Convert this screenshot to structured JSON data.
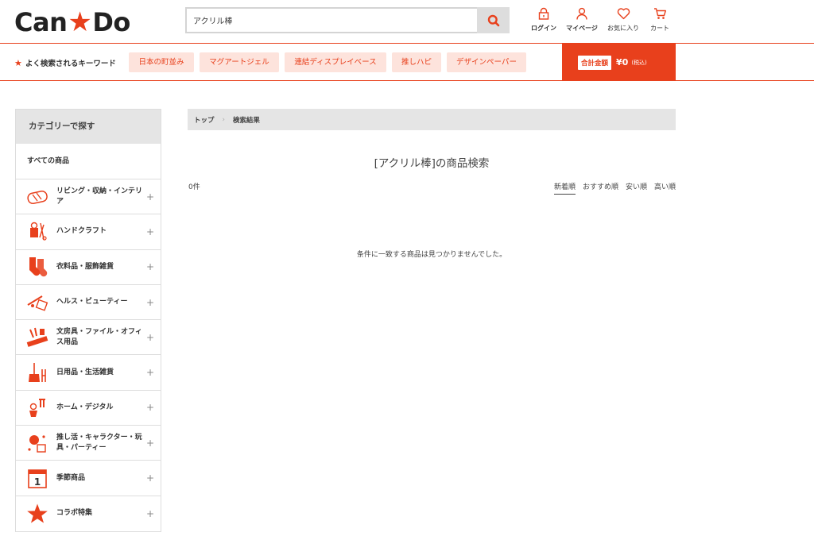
{
  "header": {
    "logo_left": "Can",
    "logo_right": "Do",
    "search_value": "アクリル棒",
    "icons": [
      {
        "name": "login",
        "label": "ログイン"
      },
      {
        "name": "mypage",
        "label": "マイページ"
      },
      {
        "name": "favorites",
        "label": "お気に入り"
      },
      {
        "name": "cart",
        "label": "カート"
      }
    ]
  },
  "keywords": {
    "title": "よく検索されるキーワード",
    "tags": [
      "日本の町並み",
      "マグアートジェル",
      "連結ディスプレイベース",
      "推しハピ",
      "デザインペーパー"
    ]
  },
  "total": {
    "label": "合計金額",
    "amount": "¥0",
    "tax": "(税込)"
  },
  "sidebar": {
    "title": "カテゴリーで探す",
    "all": "すべての商品",
    "items": [
      {
        "label": "リビング・収納・インテリア",
        "icon": "living-icon"
      },
      {
        "label": "ハンドクラフト",
        "icon": "craft-icon"
      },
      {
        "label": "衣料品・服飾雑貨",
        "icon": "socks-icon"
      },
      {
        "label": "ヘルス・ビューティー",
        "icon": "beauty-icon"
      },
      {
        "label": "文房具・ファイル・オフィス用品",
        "icon": "stationery-icon"
      },
      {
        "label": "日用品・生活雑貨",
        "icon": "broom-icon"
      },
      {
        "label": "ホーム・デジタル",
        "icon": "home-icon"
      },
      {
        "label": "推し活・キャラクター・玩具・パーティー",
        "icon": "party-icon"
      },
      {
        "label": "季節商品",
        "icon": "calendar-icon"
      },
      {
        "label": "コラボ特集",
        "icon": "star-icon"
      }
    ]
  },
  "breadcrumb": {
    "home": "トップ",
    "current": "検索結果"
  },
  "main": {
    "title": "[アクリル棒]の商品検索",
    "count": "0件",
    "sorts": [
      "新着順",
      "おすすめ順",
      "安い順",
      "高い順"
    ],
    "empty_message": "条件に一致する商品は見つかりませんでした。"
  },
  "colors": {
    "accent": "#e8401c",
    "tag_bg": "#fde3dc",
    "gray_bg": "#e5e5e5"
  }
}
